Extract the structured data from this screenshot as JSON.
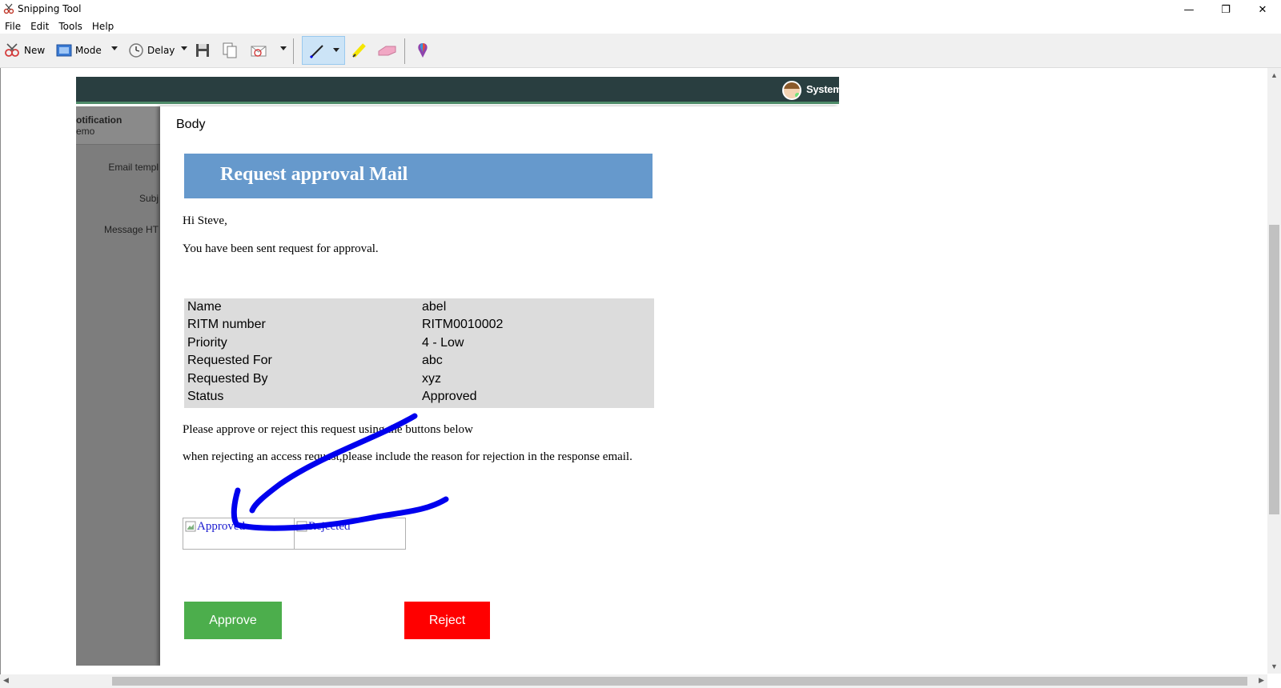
{
  "window": {
    "title": "Snipping Tool",
    "minimize": "—",
    "maximize": "❐",
    "close": "✕"
  },
  "menu": [
    "File",
    "Edit",
    "Tools",
    "Help"
  ],
  "toolbar": {
    "new_label": "New",
    "mode_label": "Mode",
    "delay_label": "Delay",
    "pen_color": "#0000ee",
    "highlighter_color": "#f5e600"
  },
  "snip": {
    "header": {
      "user_name": "System"
    },
    "left_panel": {
      "title": "otification",
      "subtitle": "emo",
      "fields": [
        "Email templ",
        "Subj",
        "Message HT"
      ]
    },
    "modal_title": "Body",
    "email": {
      "banner": "Request approval Mail",
      "greeting": "Hi Steve,",
      "intro": "You have been sent request for approval.",
      "details": [
        {
          "key": "Name",
          "value": "abel"
        },
        {
          "key": "RITM number",
          "value": "RITM0010002"
        },
        {
          "key": "Priority",
          "value": "4 - Low"
        },
        {
          "key": "Requested For",
          "value": "abc"
        },
        {
          "key": "Requested By",
          "value": "xyz"
        },
        {
          "key": "Status",
          "value": "Approved"
        }
      ],
      "instruction": "Please approve or reject this request using the buttons below",
      "rejection_note": "when rejecting an access request,please include the reason for rejection in the response email.",
      "image_approved_alt": "Approved",
      "image_rejected_alt": "Rejected",
      "approve_button": "Approve",
      "reject_button": "Reject",
      "approve_color": "#4cae4c",
      "reject_color": "#ff0000"
    }
  }
}
